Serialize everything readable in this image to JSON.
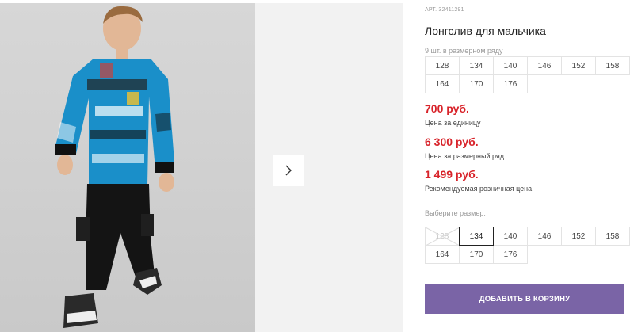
{
  "product": {
    "article": "АРТ. 32411291",
    "title": "Лонгслив для мальчика"
  },
  "series": {
    "note": "9 шт. в размерном ряду",
    "sizes": [
      "128",
      "134",
      "140",
      "146",
      "152",
      "158",
      "164",
      "170",
      "176"
    ]
  },
  "prices": {
    "unit_price": "700 руб.",
    "unit_label": "Цена за единицу",
    "series_price": "6 300 руб.",
    "series_label": "Цена за размерный ряд",
    "retail_price": "1 499 руб.",
    "retail_label": "Рекомендуемая розничная цена"
  },
  "size_picker": {
    "label": "Выберите размер:",
    "sizes": [
      "128",
      "134",
      "140",
      "146",
      "152",
      "158",
      "164",
      "170",
      "176"
    ],
    "selected": "134",
    "unavailable": "128"
  },
  "cart": {
    "add_label": "ДОБАВИТЬ В КОРЗИНУ"
  },
  "colors": {
    "price_red": "#d8232a",
    "button_purple": "#7a64a6"
  },
  "icons": {
    "next": "chevron-right-icon"
  }
}
